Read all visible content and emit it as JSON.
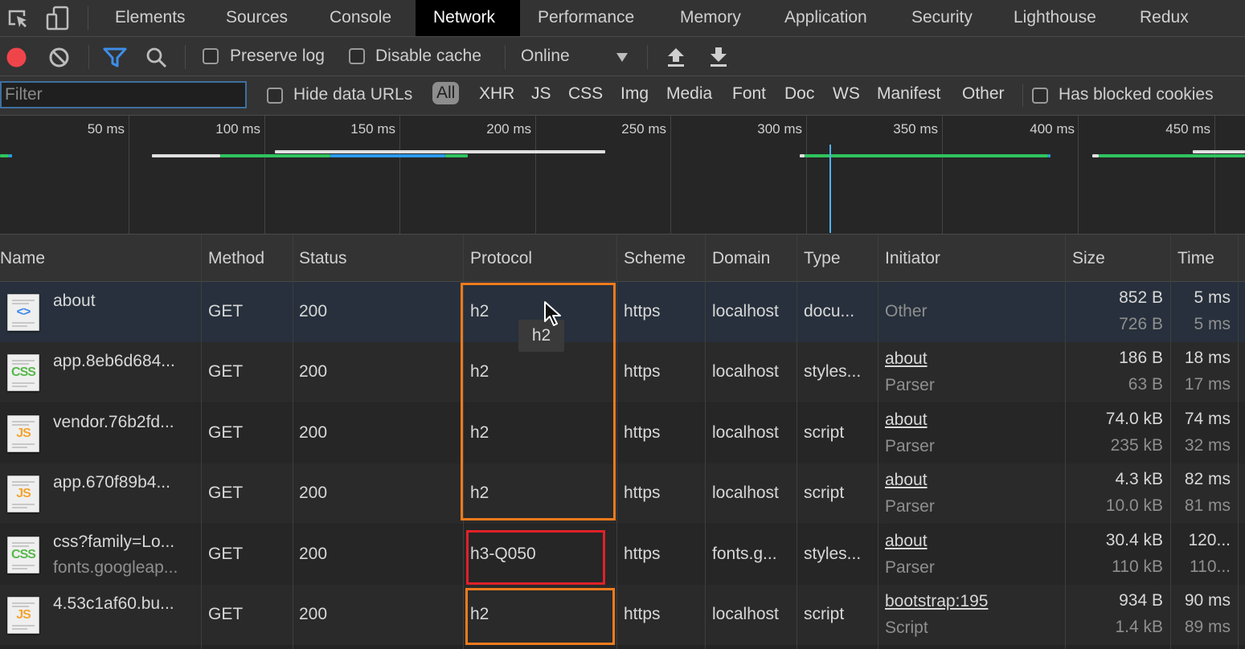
{
  "tabs": {
    "items": [
      "Elements",
      "Sources",
      "Console",
      "Network",
      "Performance",
      "Memory",
      "Application",
      "Security",
      "Lighthouse",
      "Redux"
    ],
    "active": "Network",
    "left_icons": [
      "inspect-element-icon",
      "device-toolbar-icon"
    ]
  },
  "toolbar": {
    "record_color": "#f0444b",
    "preserve_log": {
      "label": "Preserve log",
      "checked": false
    },
    "disable_cache": {
      "label": "Disable cache",
      "checked": false
    },
    "throttling": "Online",
    "icons": [
      "record-icon",
      "clear-icon",
      "filter-icon",
      "search-icon",
      "import-har-icon",
      "export-har-icon"
    ]
  },
  "filterbar": {
    "placeholder": "Filter",
    "value": "",
    "hide_data_urls": {
      "label": "Hide data URLs",
      "checked": false
    },
    "types": [
      "All",
      "XHR",
      "JS",
      "CSS",
      "Img",
      "Media",
      "Font",
      "Doc",
      "WS",
      "Manifest",
      "Other"
    ],
    "active_type": "All",
    "blocked_cookies": {
      "label": "Has blocked cookies",
      "checked": false
    }
  },
  "overview": {
    "ticks": [
      "50 ms",
      "100 ms",
      "150 ms",
      "200 ms",
      "250 ms",
      "300 ms",
      "350 ms",
      "400 ms",
      "450 ms"
    ],
    "colors": {
      "waiting": "#e0e0e0",
      "download": "#2fc45e",
      "blue": "#2b9af0",
      "cursor": "#4fb3e8"
    }
  },
  "table": {
    "headers": [
      "Name",
      "Method",
      "Status",
      "Protocol",
      "Scheme",
      "Domain",
      "Type",
      "Initiator",
      "Size",
      "Time"
    ],
    "rows": [
      {
        "icon": "html-document-icon",
        "name": "about",
        "name_sub": "",
        "method": "GET",
        "status": "200",
        "protocol": "h2",
        "scheme": "https",
        "domain": "localhost",
        "type": "docu...",
        "initiator": "Other",
        "initiator_sub": "",
        "initiator_link": false,
        "size": "852 B",
        "size_sub": "726 B",
        "time": "5 ms",
        "time_sub": "5 ms",
        "selected": true
      },
      {
        "icon": "css-file-icon",
        "name": "app.8eb6d684...",
        "name_sub": "",
        "method": "GET",
        "status": "200",
        "protocol": "h2",
        "scheme": "https",
        "domain": "localhost",
        "type": "styles...",
        "initiator": "about",
        "initiator_sub": "Parser",
        "initiator_link": true,
        "size": "186 B",
        "size_sub": "63 B",
        "time": "18 ms",
        "time_sub": "17 ms"
      },
      {
        "icon": "js-file-icon",
        "name": "vendor.76b2fd...",
        "name_sub": "",
        "method": "GET",
        "status": "200",
        "protocol": "h2",
        "scheme": "https",
        "domain": "localhost",
        "type": "script",
        "initiator": "about",
        "initiator_sub": "Parser",
        "initiator_link": true,
        "size": "74.0 kB",
        "size_sub": "235 kB",
        "time": "74 ms",
        "time_sub": "32 ms"
      },
      {
        "icon": "js-file-icon",
        "name": "app.670f89b4...",
        "name_sub": "",
        "method": "GET",
        "status": "200",
        "protocol": "h2",
        "scheme": "https",
        "domain": "localhost",
        "type": "script",
        "initiator": "about",
        "initiator_sub": "Parser",
        "initiator_link": true,
        "size": "4.3 kB",
        "size_sub": "10.0 kB",
        "time": "82 ms",
        "time_sub": "81 ms"
      },
      {
        "icon": "css-file-icon",
        "name": "css?family=Lo...",
        "name_sub": "fonts.googleap...",
        "method": "GET",
        "status": "200",
        "protocol": "h3-Q050",
        "scheme": "https",
        "domain": "fonts.g...",
        "type": "styles...",
        "initiator": "about",
        "initiator_sub": "Parser",
        "initiator_link": true,
        "size": "30.4 kB",
        "size_sub": "110 kB",
        "time": "120...",
        "time_sub": "110..."
      },
      {
        "icon": "js-file-icon",
        "name": "4.53c1af60.bu...",
        "name_sub": "",
        "method": "GET",
        "status": "200",
        "protocol": "h2",
        "scheme": "https",
        "domain": "localhost",
        "type": "script",
        "initiator": "bootstrap:195",
        "initiator_sub": "Script",
        "initiator_link": true,
        "size": "934 B",
        "size_sub": "1.4 kB",
        "time": "90 ms",
        "time_sub": "89 ms"
      }
    ]
  },
  "annotations": {
    "orange_color": "#f07b1d",
    "red_color": "#e02129"
  },
  "tooltip": {
    "text": "h2"
  }
}
